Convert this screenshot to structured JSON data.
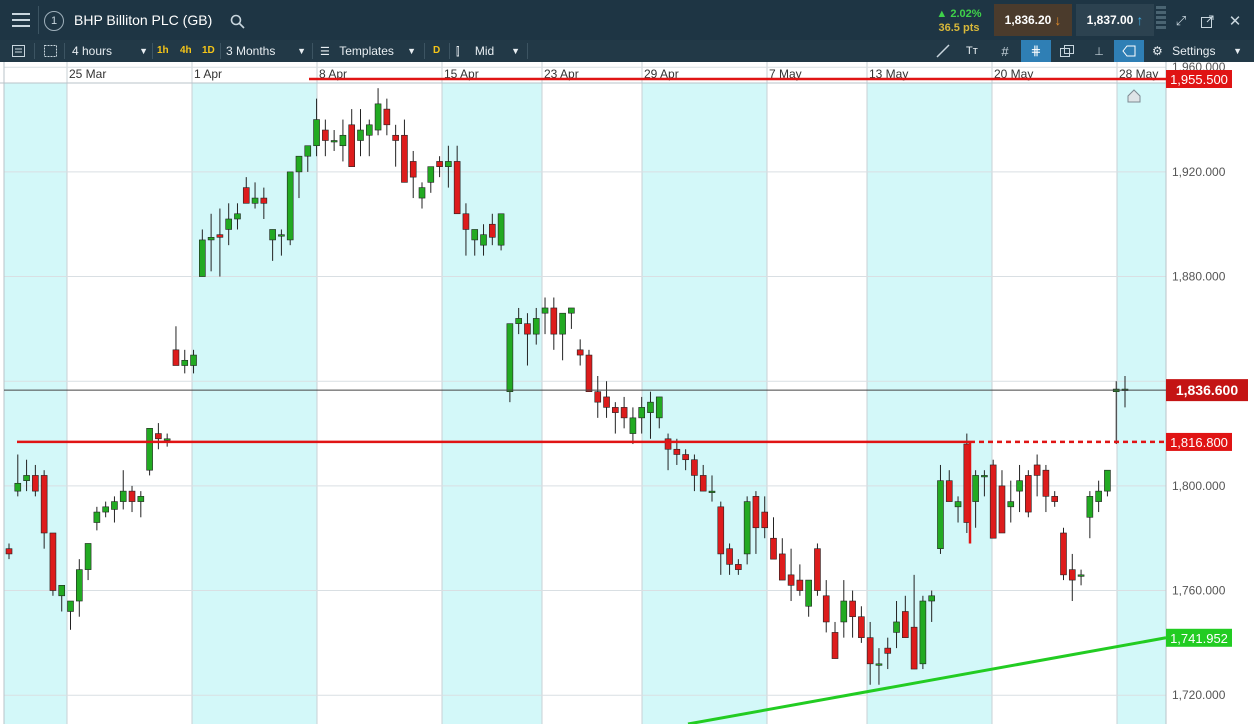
{
  "header": {
    "menu_icon": "hamburger-icon",
    "instance_number": "1",
    "title": "BHP Billiton PLC (GB)",
    "search_icon": "search-icon",
    "change_pct": "▲ 2.02%",
    "change_pts": "36.5 pts",
    "sell_price": "1,836.20",
    "buy_price": "1,837.00",
    "up_color": "#3fd24a",
    "sell_bg": "#4a3a2a",
    "buy_bg": "#2a3f4c"
  },
  "toolbar": {
    "interval": "4 hours",
    "quick_1h": "1h",
    "quick_4h": "4h",
    "quick_1d": "1D",
    "range": "3 Months",
    "templates": "Templates",
    "d_badge": "D",
    "price_type": "Mid",
    "text_tool": "Tт",
    "settings": "Settings"
  },
  "chart_data": {
    "type": "candlestick",
    "x_tick_labels": [
      "25 Mar",
      "1 Apr",
      "8 Apr",
      "15 Apr",
      "23 Apr",
      "29 Apr",
      "7 May",
      "13 May",
      "20 May",
      "28 May"
    ],
    "y_tick_labels": [
      "1,960.000",
      "1,920.000",
      "1,880.000",
      "1,800.000",
      "1,760.000",
      "1,720.000"
    ],
    "ylim": [
      1709,
      1962
    ],
    "grid": true,
    "bull_color": "#22aa22",
    "bear_color": "#dd1c1c",
    "session_shade": "#d3f8f9",
    "horizontal_lines": [
      {
        "price": 1955.5,
        "label": "1,955.500",
        "color": "#e01414"
      },
      {
        "price": 1816.8,
        "label": "1,816.800",
        "color": "#e01414"
      }
    ],
    "trend_line": {
      "label": "1,741.952",
      "color": "#22cc22",
      "points": [
        [
          1707,
          1709
        ],
        [
          1741.952,
          1741.952
        ]
      ]
    },
    "current_price": {
      "price": 1836.6,
      "label": "1,836.600",
      "color": "#c41414"
    },
    "candles": [
      [
        1776,
        1778,
        1772,
        1774
      ],
      [
        1798,
        1812,
        1796,
        1801
      ],
      [
        1802,
        1810,
        1798,
        1804
      ],
      [
        1804,
        1808,
        1796,
        1798
      ],
      [
        1804,
        1806,
        1776,
        1782
      ],
      [
        1782,
        1782,
        1758,
        1760
      ],
      [
        1758,
        1762,
        1752,
        1762
      ],
      [
        1752,
        1754,
        1745,
        1756
      ],
      [
        1756,
        1772,
        1750,
        1768
      ],
      [
        1768,
        1778,
        1764,
        1778
      ],
      [
        1786,
        1792,
        1783,
        1790
      ],
      [
        1790,
        1794,
        1788,
        1792
      ],
      [
        1791,
        1796,
        1786,
        1794
      ],
      [
        1794,
        1806,
        1791,
        1798
      ],
      [
        1798,
        1800,
        1790,
        1794
      ],
      [
        1794,
        1798,
        1788,
        1796
      ],
      [
        1806,
        1820,
        1804,
        1822
      ],
      [
        1820,
        1824,
        1814,
        1818
      ],
      [
        1818,
        1820,
        1815,
        1818
      ],
      [
        1852,
        1861,
        1846,
        1846
      ],
      [
        1846,
        1852,
        1843,
        1848
      ],
      [
        1846,
        1852,
        1843,
        1850
      ],
      [
        1880,
        1898,
        1880,
        1894
      ],
      [
        1894,
        1904,
        1882,
        1895
      ],
      [
        1896,
        1906,
        1880,
        1895
      ],
      [
        1898,
        1908,
        1892,
        1902
      ],
      [
        1902,
        1908,
        1898,
        1904
      ],
      [
        1914,
        1918,
        1908,
        1908
      ],
      [
        1908,
        1916,
        1906,
        1910
      ],
      [
        1910,
        1914,
        1902,
        1908
      ],
      [
        1894,
        1898,
        1886,
        1898
      ],
      [
        1896,
        1898,
        1888,
        1896
      ],
      [
        1894,
        1912,
        1892,
        1920
      ],
      [
        1920,
        1926,
        1910,
        1926
      ],
      [
        1926,
        1930,
        1920,
        1930
      ],
      [
        1930,
        1948,
        1926,
        1940
      ],
      [
        1936,
        1940,
        1926,
        1932
      ],
      [
        1932,
        1936,
        1928,
        1932
      ],
      [
        1930,
        1940,
        1924,
        1934
      ],
      [
        1938,
        1944,
        1922,
        1922
      ],
      [
        1932,
        1944,
        1926,
        1936
      ],
      [
        1934,
        1940,
        1926,
        1938
      ],
      [
        1936,
        1952,
        1934,
        1946
      ],
      [
        1944,
        1948,
        1934,
        1938
      ],
      [
        1934,
        1938,
        1922,
        1932
      ],
      [
        1934,
        1940,
        1916,
        1916
      ],
      [
        1924,
        1928,
        1910,
        1918
      ],
      [
        1910,
        1916,
        1906,
        1914
      ],
      [
        1916,
        1920,
        1912,
        1922
      ],
      [
        1924,
        1926,
        1918,
        1922
      ],
      [
        1922,
        1930,
        1914,
        1924
      ],
      [
        1924,
        1930,
        1904,
        1904
      ],
      [
        1904,
        1908,
        1888,
        1898
      ],
      [
        1894,
        1898,
        1888,
        1898
      ],
      [
        1892,
        1900,
        1888,
        1896
      ],
      [
        1900,
        1904,
        1892,
        1895
      ],
      [
        1892,
        1902,
        1890,
        1904
      ],
      [
        1836,
        1862,
        1832,
        1862
      ],
      [
        1862,
        1868,
        1858,
        1864
      ],
      [
        1862,
        1866,
        1846,
        1858
      ],
      [
        1858,
        1868,
        1854,
        1864
      ],
      [
        1866,
        1872,
        1858,
        1868
      ],
      [
        1868,
        1872,
        1852,
        1858
      ],
      [
        1858,
        1866,
        1848,
        1866
      ],
      [
        1866,
        1868,
        1860,
        1868
      ],
      [
        1852,
        1856,
        1846,
        1850
      ],
      [
        1850,
        1852,
        1836,
        1836
      ],
      [
        1836,
        1842,
        1826,
        1832
      ],
      [
        1834,
        1840,
        1826,
        1830
      ],
      [
        1830,
        1832,
        1820,
        1828
      ],
      [
        1830,
        1834,
        1822,
        1826
      ],
      [
        1820,
        1830,
        1816,
        1826
      ],
      [
        1826,
        1834,
        1820,
        1830
      ],
      [
        1828,
        1836,
        1818,
        1832
      ],
      [
        1826,
        1834,
        1822,
        1834
      ],
      [
        1818,
        1820,
        1806,
        1814
      ],
      [
        1814,
        1818,
        1808,
        1812
      ],
      [
        1812,
        1814,
        1806,
        1810
      ],
      [
        1810,
        1812,
        1798,
        1804
      ],
      [
        1804,
        1808,
        1798,
        1798
      ],
      [
        1798,
        1804,
        1794,
        1798
      ],
      [
        1792,
        1794,
        1766,
        1774
      ],
      [
        1776,
        1778,
        1766,
        1770
      ],
      [
        1770,
        1772,
        1766,
        1768
      ],
      [
        1774,
        1796,
        1770,
        1794
      ],
      [
        1796,
        1798,
        1774,
        1784
      ],
      [
        1790,
        1796,
        1780,
        1784
      ],
      [
        1780,
        1788,
        1774,
        1772
      ],
      [
        1774,
        1780,
        1764,
        1764
      ],
      [
        1766,
        1776,
        1756,
        1762
      ],
      [
        1764,
        1770,
        1758,
        1760
      ],
      [
        1754,
        1762,
        1750,
        1764
      ],
      [
        1776,
        1778,
        1758,
        1760
      ],
      [
        1758,
        1764,
        1744,
        1748
      ],
      [
        1744,
        1748,
        1734,
        1734
      ],
      [
        1748,
        1764,
        1742,
        1756
      ],
      [
        1756,
        1760,
        1742,
        1750
      ],
      [
        1750,
        1754,
        1740,
        1742
      ],
      [
        1742,
        1748,
        1724,
        1732
      ],
      [
        1732,
        1738,
        1724,
        1732
      ],
      [
        1738,
        1742,
        1730,
        1736
      ],
      [
        1744,
        1756,
        1738,
        1748
      ],
      [
        1752,
        1758,
        1742,
        1742
      ],
      [
        1746,
        1766,
        1730,
        1730
      ],
      [
        1732,
        1758,
        1730,
        1756
      ],
      [
        1756,
        1760,
        1748,
        1758
      ],
      [
        1776,
        1808,
        1774,
        1802
      ],
      [
        1802,
        1806,
        1794,
        1794
      ],
      [
        1792,
        1796,
        1786,
        1794
      ],
      [
        1816,
        1820,
        1782,
        1786
      ],
      [
        1794,
        1806,
        1784,
        1804
      ],
      [
        1804,
        1806,
        1796,
        1804
      ],
      [
        1808,
        1810,
        1780,
        1780
      ],
      [
        1800,
        1806,
        1782,
        1782
      ],
      [
        1792,
        1802,
        1786,
        1794
      ],
      [
        1798,
        1808,
        1790,
        1802
      ],
      [
        1804,
        1806,
        1788,
        1790
      ],
      [
        1808,
        1812,
        1796,
        1804
      ],
      [
        1806,
        1808,
        1790,
        1796
      ],
      [
        1796,
        1798,
        1792,
        1794
      ],
      [
        1782,
        1784,
        1764,
        1766
      ],
      [
        1768,
        1774,
        1756,
        1764
      ],
      [
        1766,
        1768,
        1762,
        1766
      ],
      [
        1788,
        1798,
        1780,
        1796
      ],
      [
        1794,
        1802,
        1790,
        1798
      ],
      [
        1798,
        1806,
        1796,
        1806
      ],
      [
        1836,
        1840,
        1816,
        1837
      ],
      [
        1837,
        1842,
        1830,
        1837
      ]
    ]
  }
}
